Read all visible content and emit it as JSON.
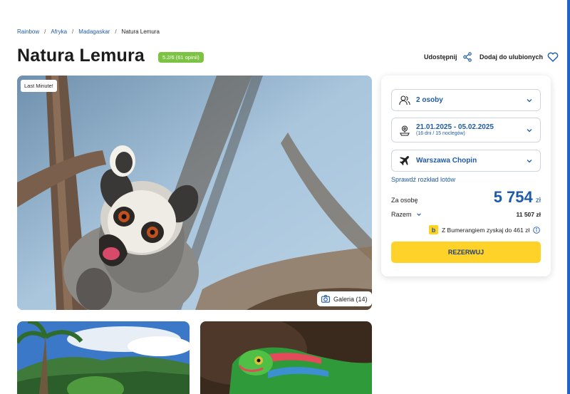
{
  "breadcrumb": [
    "Rainbow",
    "Afryka",
    "Madagaskar",
    "Natura Lemura"
  ],
  "title": "Natura Lemura",
  "rating": "5.2/6 (61 opinii)",
  "actions": {
    "share": "Udostępnij",
    "favorite": "Dodaj do ulubionych"
  },
  "photo": {
    "badge": "Last Minute!",
    "gallery": "Galeria (14)"
  },
  "booking": {
    "persons": "2 osoby",
    "dates": "21.01.2025 - 05.02.2025",
    "duration": "(16 dni / 15 noclegów)",
    "airport": "Warszawa Chopin",
    "schedule_link": "Sprawdź rozkład lotów",
    "per_person_label": "Za osobę",
    "price": "5 754",
    "currency": "zł",
    "total_label": "Razem",
    "total_value": "11 507 zł",
    "boomerang": "Z Bumerangiem zyskaj do 461 zł",
    "reserve": "REZERWUJ"
  },
  "colors": {
    "accent": "#1e5aa8",
    "rating": "#7cc243",
    "cta": "#ffd22a"
  }
}
